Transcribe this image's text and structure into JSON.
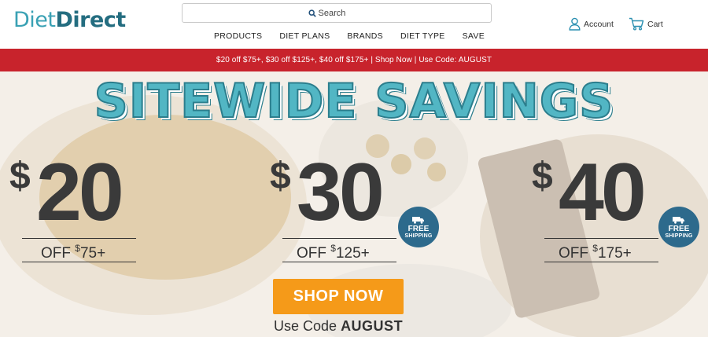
{
  "brand": {
    "logo_part1": "Diet",
    "logo_part2": "Direct"
  },
  "search": {
    "placeholder": "Search"
  },
  "nav": [
    {
      "label": "PRODUCTS"
    },
    {
      "label": "DIET PLANS"
    },
    {
      "label": "BRANDS"
    },
    {
      "label": "DIET TYPE"
    },
    {
      "label": "SAVE"
    }
  ],
  "header": {
    "account_label": "Account",
    "cart_label": "Cart",
    "account_icon": "user-icon",
    "cart_icon": "cart-icon"
  },
  "promo_bar": {
    "text": "$20 off $75+, $30 off $125+, $40 off $175+ | Shop Now | Use Code: AUGUST",
    "color": "#c8232c"
  },
  "hero": {
    "headline": "SITEWIDE SAVINGS",
    "offers": [
      {
        "currency": "$",
        "amount": "20",
        "off_label": "OFF",
        "min_currency": "$",
        "min": "75+"
      },
      {
        "currency": "$",
        "amount": "30",
        "off_label": "OFF",
        "min_currency": "$",
        "min": "125+",
        "badge_line1": "FREE",
        "badge_line2": "SHIPPING"
      },
      {
        "currency": "$",
        "amount": "40",
        "off_label": "OFF",
        "min_currency": "$",
        "min": "175+",
        "badge_line1": "FREE",
        "badge_line2": "SHIPPING"
      }
    ],
    "cta_label": "SHOP NOW",
    "code_prefix": "Use Code",
    "code": "AUGUST",
    "accent_color": "#52b6c4",
    "cta_color": "#f59a19",
    "badge_color": "#2d6a8c"
  }
}
